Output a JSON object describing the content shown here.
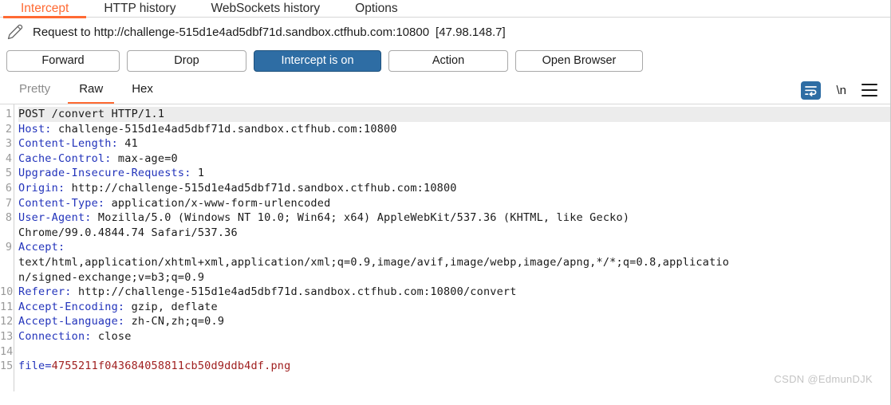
{
  "top_tabs": [
    {
      "label": "Intercept",
      "active": true
    },
    {
      "label": "HTTP history",
      "active": false
    },
    {
      "label": "WebSockets history",
      "active": false
    },
    {
      "label": "Options",
      "active": false
    }
  ],
  "request_bar": {
    "icon": "pencil-icon",
    "text": "Request to http://challenge-515d1e4ad5dbf71d.sandbox.ctfhub.com:10800",
    "ip": "[47.98.148.7]"
  },
  "buttons": {
    "forward": "Forward",
    "drop": "Drop",
    "intercept": "Intercept is on",
    "action": "Action",
    "open_browser": "Open Browser"
  },
  "view_tabs": [
    {
      "label": "Pretty",
      "active": false,
      "dim": true
    },
    {
      "label": "Raw",
      "active": true,
      "dim": false
    },
    {
      "label": "Hex",
      "active": false,
      "dim": false
    }
  ],
  "view_tools": {
    "wrap_icon": "word-wrap-icon",
    "newline_label": "\\n",
    "menu_icon": "hamburger-menu-icon"
  },
  "editor": {
    "line_numbers": [
      "1",
      "2",
      "3",
      "4",
      "5",
      "6",
      "7",
      "8",
      "",
      "9",
      "",
      "",
      "10",
      "11",
      "12",
      "13",
      "14",
      "15"
    ],
    "lines": [
      {
        "text": "POST /convert HTTP/1.1",
        "type": "plain",
        "highlight": true
      },
      {
        "header": "Host:",
        "value": " challenge-515d1e4ad5dbf71d.sandbox.ctfhub.com:10800",
        "type": "header"
      },
      {
        "header": "Content-Length:",
        "value": " 41",
        "type": "header"
      },
      {
        "header": "Cache-Control:",
        "value": " max-age=0",
        "type": "header"
      },
      {
        "header": "Upgrade-Insecure-Requests:",
        "value": " 1",
        "type": "header"
      },
      {
        "header": "Origin:",
        "value": " http://challenge-515d1e4ad5dbf71d.sandbox.ctfhub.com:10800",
        "type": "header"
      },
      {
        "header": "Content-Type:",
        "value": " application/x-www-form-urlencoded",
        "type": "header"
      },
      {
        "header": "User-Agent:",
        "value": " Mozilla/5.0 (Windows NT 10.0; Win64; x64) AppleWebKit/537.36 (KHTML, like Gecko)",
        "type": "header"
      },
      {
        "text": "Chrome/99.0.4844.74 Safari/537.36",
        "type": "plain"
      },
      {
        "header": "Accept:",
        "value": "",
        "type": "header"
      },
      {
        "text": "text/html,application/xhtml+xml,application/xml;q=0.9,image/avif,image/webp,image/apng,*/*;q=0.8,applicatio",
        "type": "plain"
      },
      {
        "text": "n/signed-exchange;v=b3;q=0.9",
        "type": "plain"
      },
      {
        "header": "Referer:",
        "value": " http://challenge-515d1e4ad5dbf71d.sandbox.ctfhub.com:10800/convert",
        "type": "header"
      },
      {
        "header": "Accept-Encoding:",
        "value": " gzip, deflate",
        "type": "header"
      },
      {
        "header": "Accept-Language:",
        "value": " zh-CN,zh;q=0.9",
        "type": "header"
      },
      {
        "header": "Connection:",
        "value": " close",
        "type": "header"
      },
      {
        "text": "",
        "type": "plain"
      },
      {
        "body_key": "file=",
        "body_value": "4755211f043684058811cb50d9ddb4df.png",
        "type": "body"
      }
    ]
  },
  "watermark": "CSDN @EdmunDJK",
  "colors": {
    "accent_orange": "#ff6a33",
    "button_blue": "#2e6da4",
    "header_blue": "#2233bb",
    "body_red": "#a02020"
  }
}
